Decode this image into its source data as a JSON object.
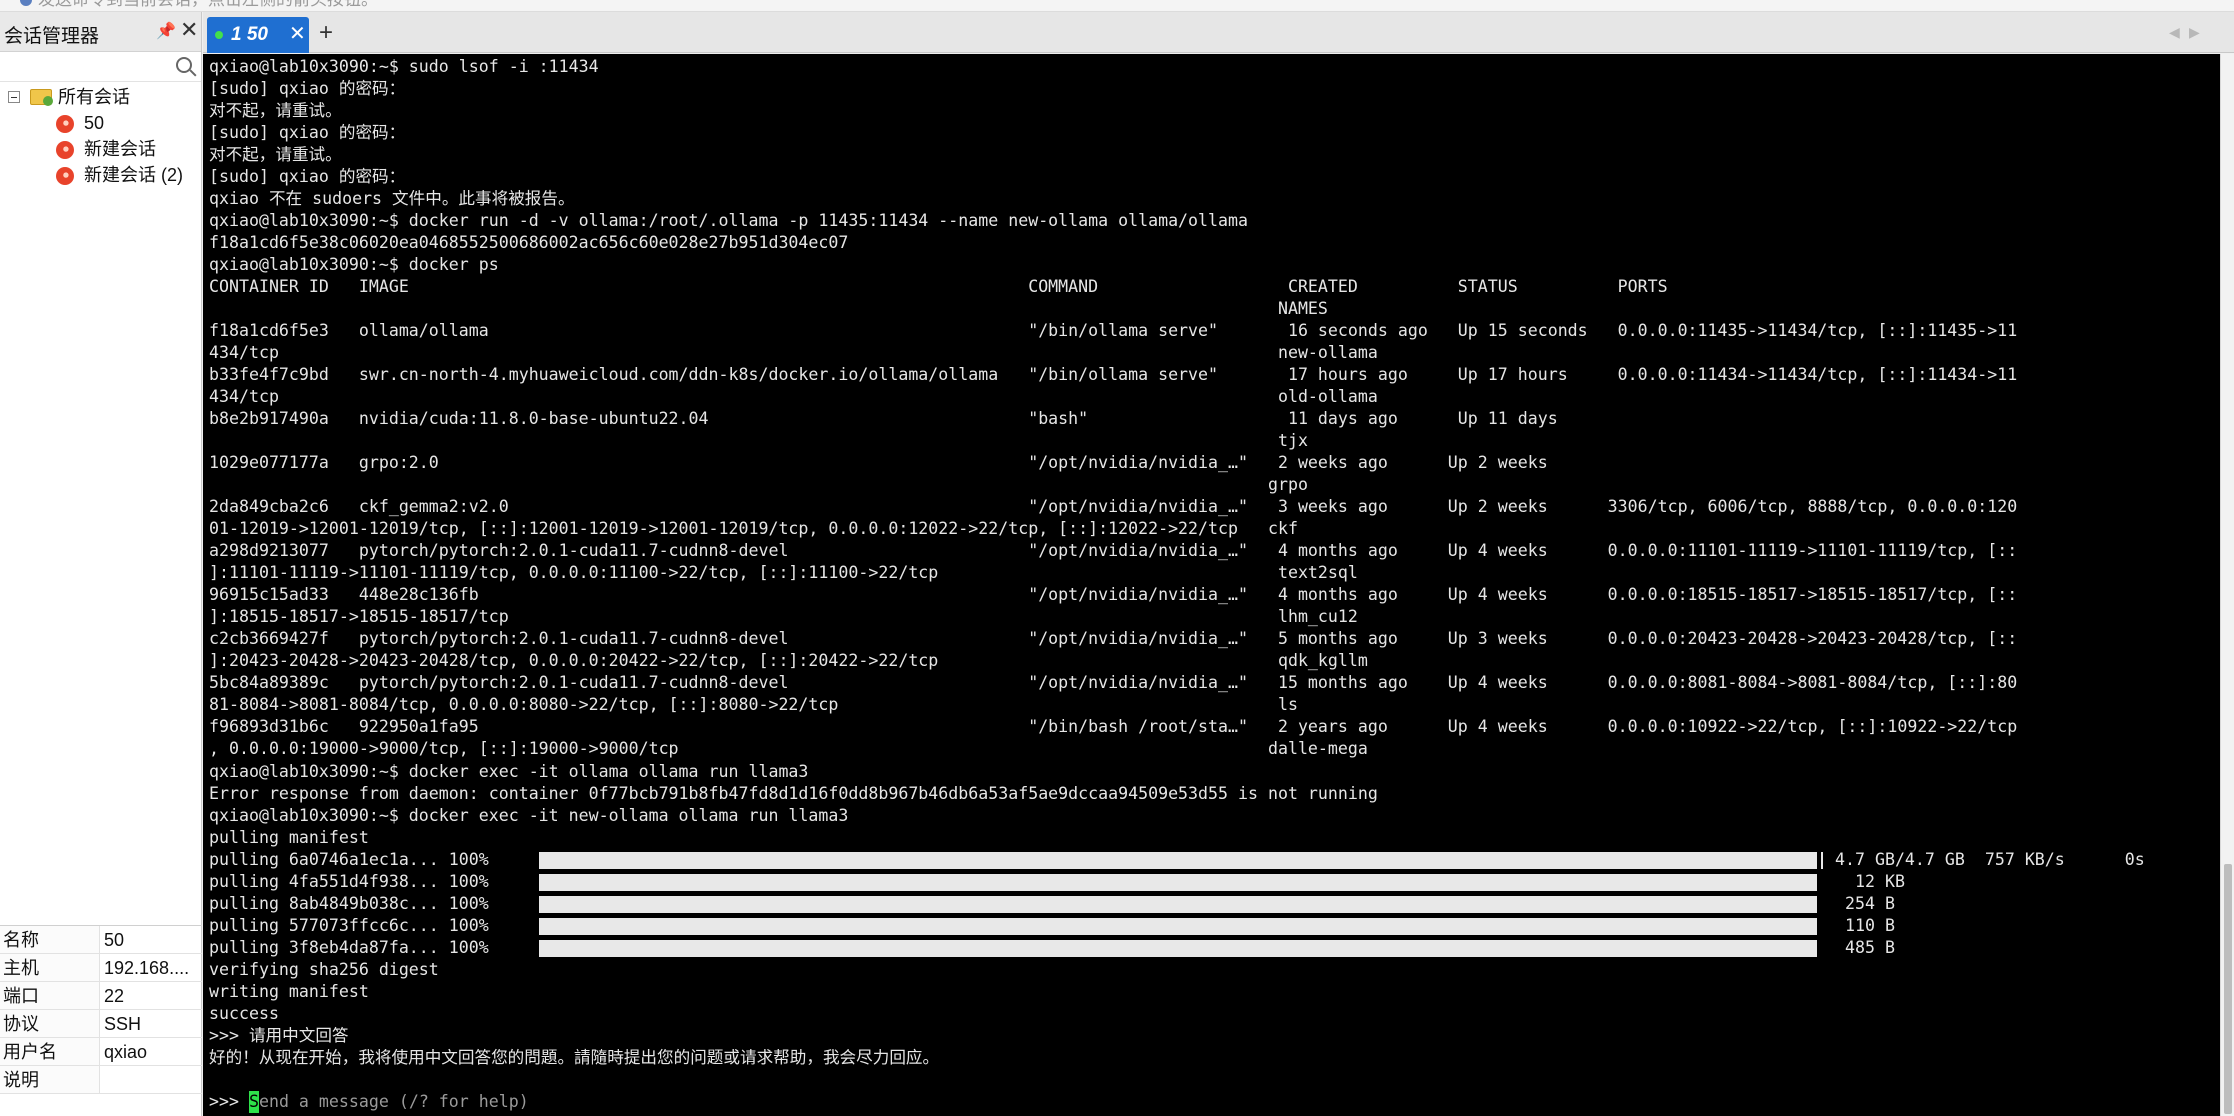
{
  "topbar": {
    "hint": "发送命令到当前会话，点击左侧的箭头按钮。"
  },
  "left_panel": {
    "title": "会话管理器",
    "pin_icon": "pin-icon",
    "close_icon": "close-icon",
    "search_placeholder": "",
    "tree": {
      "root_label": "所有会话",
      "items": [
        {
          "label": "50"
        },
        {
          "label": "新建会话"
        },
        {
          "label": "新建会话 (2)"
        }
      ]
    },
    "properties": [
      {
        "key": "名称",
        "value": "50"
      },
      {
        "key": "主机",
        "value": "192.168...."
      },
      {
        "key": "端口",
        "value": "22"
      },
      {
        "key": "协议",
        "value": "SSH"
      },
      {
        "key": "用户名",
        "value": "qxiao"
      },
      {
        "key": "说明",
        "value": ""
      }
    ]
  },
  "tabs": {
    "items": [
      {
        "label": "1 50",
        "status_color": "#43e04c"
      }
    ],
    "new_tab_label": "+",
    "close_label": "✕",
    "scroll_left": "◀",
    "scroll_right": "▶"
  },
  "terminal": {
    "lines": [
      "qxiao@lab10x3090:~$ sudo lsof -i :11434",
      "[sudo] qxiao 的密码：",
      "对不起，请重试。",
      "[sudo] qxiao 的密码：",
      "对不起，请重试。",
      "[sudo] qxiao 的密码：",
      "qxiao 不在 sudoers 文件中。此事将被报告。",
      "qxiao@lab10x3090:~$ docker run -d -v ollama:/root/.ollama -p 11435:11434 --name new-ollama ollama/ollama",
      "f18a1cd6f5e38c06020ea0468552500686002ac656c60e028e27b951d304ec07",
      "qxiao@lab10x3090:~$ docker ps",
      "CONTAINER ID   IMAGE                                                              COMMAND                   CREATED          STATUS          PORTS",
      "                                                                                                           NAMES",
      "f18a1cd6f5e3   ollama/ollama                                                      \"/bin/ollama serve\"       16 seconds ago   Up 15 seconds   0.0.0.0:11435->11434/tcp, [::]:11435->11",
      "434/tcp                                                                                                    new-ollama",
      "b33fe4f7c9bd   swr.cn-north-4.myhuaweicloud.com/ddn-k8s/docker.io/ollama/ollama   \"/bin/ollama serve\"       17 hours ago     Up 17 hours     0.0.0.0:11434->11434/tcp, [::]:11434->11",
      "434/tcp                                                                                                    old-ollama",
      "b8e2b917490a   nvidia/cuda:11.8.0-base-ubuntu22.04                                \"bash\"                    11 days ago      Up 11 days",
      "                                                                                                           tjx",
      "1029e077177a   grpo:2.0                                                           \"/opt/nvidia/nvidia_…\"   2 weeks ago      Up 2 weeks",
      "                                                                                                          grpo",
      "2da849cba2c6   ckf_gemma2:v2.0                                                    \"/opt/nvidia/nvidia_…\"   3 weeks ago      Up 2 weeks      3306/tcp, 6006/tcp, 8888/tcp, 0.0.0.0:120",
      "01-12019->12001-12019/tcp, [::]:12001-12019->12001-12019/tcp, 0.0.0.0:12022->22/tcp, [::]:12022->22/tcp   ckf",
      "a298d9213077   pytorch/pytorch:2.0.1-cuda11.7-cudnn8-devel                        \"/opt/nvidia/nvidia_…\"   4 months ago     Up 4 weeks      0.0.0.0:11101-11119->11101-11119/tcp, [::",
      "]:11101-11119->11101-11119/tcp, 0.0.0.0:11100->22/tcp, [::]:11100->22/tcp                                  text2sql",
      "96915c15ad33   448e28c136fb                                                       \"/opt/nvidia/nvidia_…\"   4 months ago     Up 4 weeks      0.0.0.0:18515-18517->18515-18517/tcp, [::",
      "]:18515-18517->18515-18517/tcp                                                                             lhm_cu12",
      "c2cb3669427f   pytorch/pytorch:2.0.1-cuda11.7-cudnn8-devel                        \"/opt/nvidia/nvidia_…\"   5 months ago     Up 3 weeks      0.0.0.0:20423-20428->20423-20428/tcp, [::",
      "]:20423-20428->20423-20428/tcp, 0.0.0.0:20422->22/tcp, [::]:20422->22/tcp                                  qdk_kgllm",
      "5bc84a89389c   pytorch/pytorch:2.0.1-cuda11.7-cudnn8-devel                        \"/opt/nvidia/nvidia_…\"   15 months ago    Up 4 weeks      0.0.0.0:8081-8084->8081-8084/tcp, [::]:80",
      "81-8084->8081-8084/tcp, 0.0.0.0:8080->22/tcp, [::]:8080->22/tcp                                            ls",
      "f96893d31b6c   922950a1fa95                                                       \"/bin/bash /root/sta…\"   2 years ago      Up 4 weeks      0.0.0.0:10922->22/tcp, [::]:10922->22/tcp",
      ", 0.0.0.0:19000->9000/tcp, [::]:19000->9000/tcp                                                           dalle-mega",
      "qxiao@lab10x3090:~$ docker exec -it ollama ollama run llama3",
      "Error response from daemon: container 0f77bcb791b8fb47fd8d1d16f0dd8b967b46db6a53af5ae9dccaa94509e53d55 is not running",
      "qxiao@lab10x3090:~$ docker exec -it new-ollama ollama run llama3",
      "pulling manifest"
    ],
    "pulls": [
      {
        "label": "pulling 6a0746a1ec1a... 100%",
        "info": "4.7 GB/4.7 GB  757 KB/s      0s",
        "progress": 100
      },
      {
        "label": "pulling 4fa551d4f938... 100%",
        "info": "  12 KB",
        "progress": 100
      },
      {
        "label": "pulling 8ab4849b038c... 100%",
        "info": " 254 B",
        "progress": 100
      },
      {
        "label": "pulling 577073ffcc6c... 100%",
        "info": " 110 B",
        "progress": 100
      },
      {
        "label": "pulling 3f8eb4da87fa... 100%",
        "info": " 485 B",
        "progress": 100
      }
    ],
    "after_lines": [
      "verifying sha256 digest",
      "writing manifest",
      "success",
      ">>> 请用中文回答",
      "好的！从现在开始，我将使用中文回答您的問題。請隨時提出您的问题或请求帮助，我会尽力回应。",
      ""
    ],
    "prompt": ">>> ",
    "cursor_char": "S",
    "input_placeholder": "end a message (/? for help)",
    "colors": {
      "background": "#000000",
      "text": "#e6e6e6",
      "cursor": "#2ee04a"
    }
  }
}
